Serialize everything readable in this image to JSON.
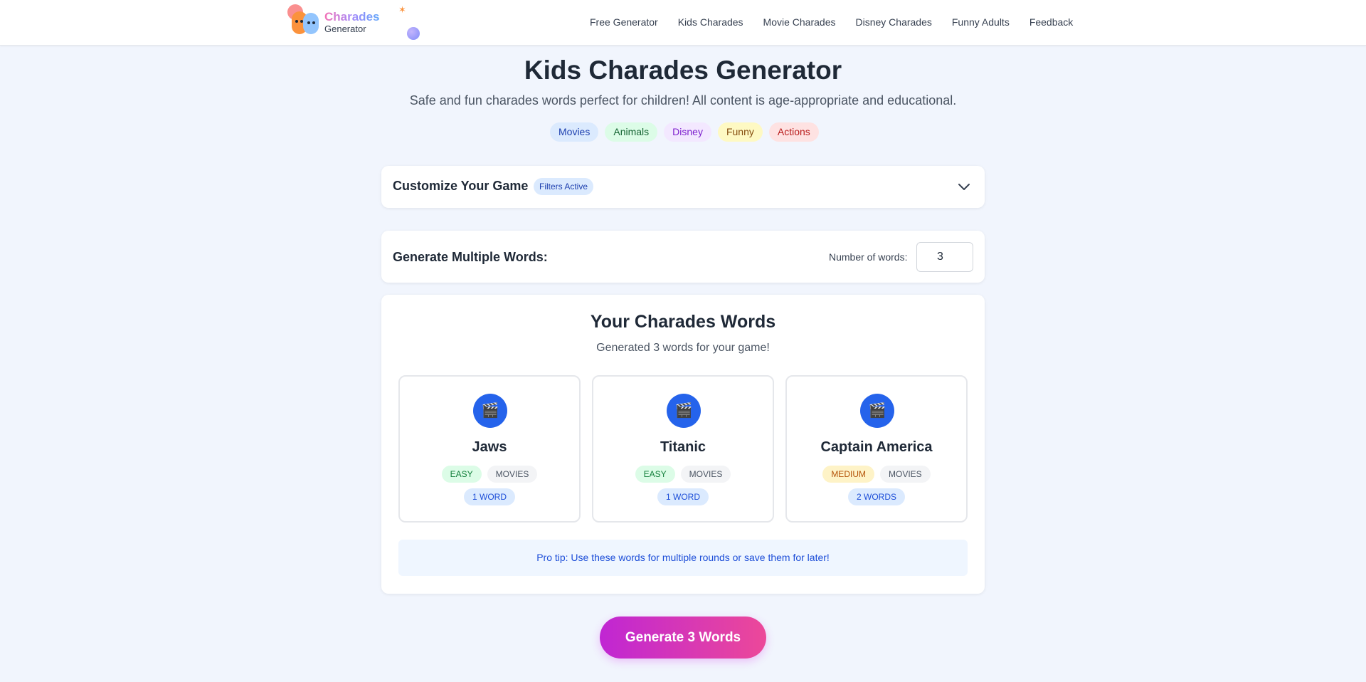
{
  "header": {
    "logo_title": "Charades",
    "logo_subtitle": "Generator",
    "nav": [
      "Free Generator",
      "Kids Charades",
      "Movie Charades",
      "Disney Charades",
      "Funny Adults",
      "Feedback"
    ]
  },
  "hero": {
    "title": "Kids Charades Generator",
    "subtitle": "Safe and fun charades words perfect for children! All content is age-appropriate and educational.",
    "tags": [
      {
        "label": "Movies",
        "bg": "#dbeafe",
        "color": "#1e40af"
      },
      {
        "label": "Animals",
        "bg": "#dcfce7",
        "color": "#166534"
      },
      {
        "label": "Disney",
        "bg": "#f3e8ff",
        "color": "#7e22ce"
      },
      {
        "label": "Funny",
        "bg": "#fef9c3",
        "color": "#854d0e"
      },
      {
        "label": "Actions",
        "bg": "#fee2e2",
        "color": "#b91c1c"
      }
    ]
  },
  "customize": {
    "title": "Customize Your Game",
    "badge": "Filters Active",
    "icon": "chevron-down-icon"
  },
  "multiple": {
    "title": "Generate Multiple Words:",
    "label": "Number of words:",
    "value": "3"
  },
  "results": {
    "title": "Your Charades Words",
    "subtitle": "Generated 3 words for your game!",
    "words": [
      {
        "icon": "🎬",
        "word": "Jaws",
        "difficulty": "EASY",
        "category": "MOVIES",
        "length": "1 WORD"
      },
      {
        "icon": "🎬",
        "word": "Titanic",
        "difficulty": "EASY",
        "category": "MOVIES",
        "length": "1 WORD"
      },
      {
        "icon": "🎬",
        "word": "Captain America",
        "difficulty": "MEDIUM",
        "category": "MOVIES",
        "length": "2 WORDS"
      }
    ],
    "tip": "Pro tip: Use these words for multiple rounds or save them for later!"
  },
  "generate_button": "Generate 3 Words"
}
